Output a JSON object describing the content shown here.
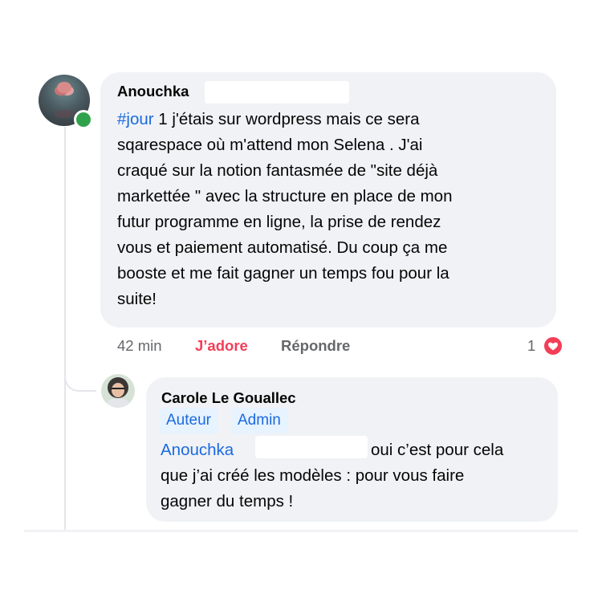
{
  "comment": {
    "author": "Anouchka",
    "hashtag": "#jour",
    "text_lines": [
      " 1 j'étais sur wordpress mais ce sera",
      "sqarespace où m'attend mon Selena . J'ai",
      "craqué sur la notion fantasmée de \"site déjà",
      "markettée \" avec la structure en place de mon",
      "futur programme en ligne, la prise de rendez",
      "vous et paiement automatisé. Du coup ça me",
      "booste et me fait gagner un temps fou pour la",
      "suite!"
    ],
    "time": "42 min",
    "like_label": "J’adore",
    "reply_label": "Répondre",
    "reaction_count": "1",
    "reaction_icon": "heart-reaction-icon",
    "online_color": "#31a24c"
  },
  "reply": {
    "author": "Carole Le Gouallec",
    "badges": [
      "Auteur",
      "Admin"
    ],
    "mention": "Anouchka",
    "lines": [
      "oui c’est pour cela",
      "que j’ai créé les modèles : pour vous faire",
      "gagner du temps !"
    ]
  },
  "colors": {
    "bubble": "#f0f2f5",
    "link": "#1b6ae0",
    "like": "#f33e58",
    "muted": "#65676b"
  }
}
